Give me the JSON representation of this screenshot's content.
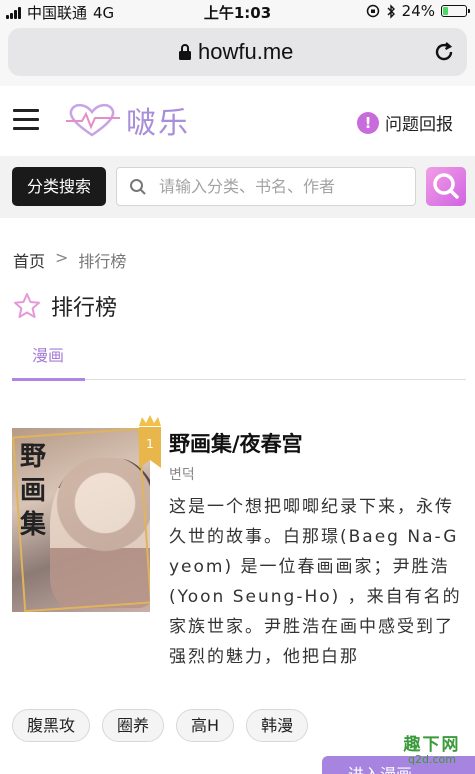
{
  "status_bar": {
    "carrier": "中国联通",
    "network": "4G",
    "time": "上午1:03",
    "battery": "24%",
    "battery_level": 0.24
  },
  "browser": {
    "url": "howfu.me"
  },
  "header": {
    "logo_text": "啵乐",
    "feedback_label": "问题回报",
    "feedback_icon": "!"
  },
  "search": {
    "category_button": "分类搜索",
    "placeholder": "请输入分类、书名、作者"
  },
  "breadcrumb": {
    "home": "首页",
    "separator": ">",
    "current": "排行榜"
  },
  "page_title": "排行榜",
  "tabs": {
    "active": "漫画"
  },
  "book": {
    "rank": "1",
    "title": "野画集/夜春宫",
    "author": "변덕",
    "cover_text": "野画集",
    "description": "这是一个想把唧唧纪录下来，永传久世的故事。白那璟(Baeg Na-Gyeom) 是一位春画画家；尹胜浩 (Yoon Seung-Ho) ，来自有名的家族世家。尹胜浩在画中感受到了强烈的魅力，他把白那",
    "tags": [
      "腹黑攻",
      "圈养",
      "高H",
      "韩漫"
    ],
    "read_button": "进入漫画"
  },
  "watermark": {
    "line1": "趣下网",
    "line2": "q2d.com"
  },
  "colors": {
    "accent": "#a57cd8",
    "search_button": "#d063e2",
    "rank_badge": "#e8b64a"
  }
}
